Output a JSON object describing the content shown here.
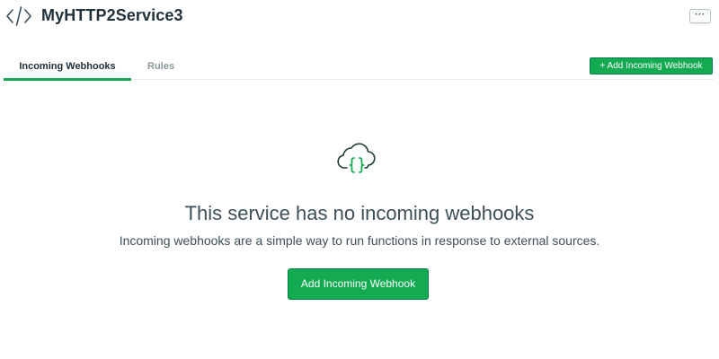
{
  "header": {
    "service_icon": "code-brackets-icon",
    "title": "MyHTTP2Service3",
    "more_button_label": "···"
  },
  "tabs": [
    {
      "label": "Incoming Webhooks",
      "active": true
    },
    {
      "label": "Rules",
      "active": false
    }
  ],
  "toolbar": {
    "add_label": "+ Add Incoming Webhook"
  },
  "empty_state": {
    "icon": "cloud-braces-icon",
    "title": "This service has no incoming webhooks",
    "description": "Incoming webhooks are a simple way to run functions in response to external sources.",
    "button_label": "Add Incoming Webhook"
  },
  "colors": {
    "accent": "#13aa52",
    "accent_border": "#09804c",
    "text": "#3d4f58",
    "muted": "#89989b"
  }
}
